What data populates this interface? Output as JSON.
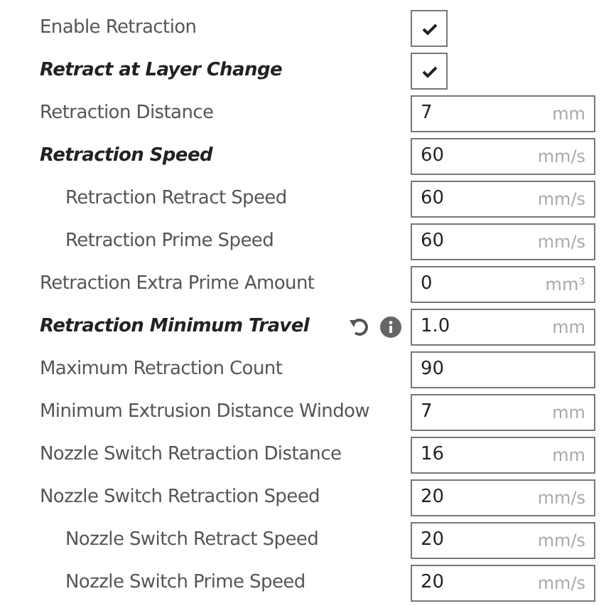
{
  "settings": [
    {
      "label": "Enable Retraction",
      "kind": "checkbox",
      "modified": false,
      "hovered": false,
      "checked": true
    },
    {
      "label": "Retract at Layer Change",
      "kind": "checkbox",
      "modified": true,
      "hovered": false,
      "checked": true
    },
    {
      "label": "Retraction Distance",
      "kind": "number",
      "modified": false,
      "hovered": false,
      "value": "7",
      "unit": "mm"
    },
    {
      "label": "Retraction Speed",
      "kind": "number",
      "modified": true,
      "hovered": false,
      "value": "60",
      "unit": "mm/s",
      "children": [
        {
          "label": "Retraction Retract Speed",
          "kind": "number",
          "modified": false,
          "hovered": false,
          "value": "60",
          "unit": "mm/s"
        },
        {
          "label": "Retraction Prime Speed",
          "kind": "number",
          "modified": false,
          "hovered": false,
          "value": "60",
          "unit": "mm/s"
        }
      ]
    },
    {
      "label": "Retraction Extra Prime Amount",
      "kind": "number",
      "modified": false,
      "hovered": false,
      "value": "0",
      "unit": "mm³"
    },
    {
      "label": "Retraction Minimum Travel",
      "kind": "number",
      "modified": true,
      "hovered": true,
      "value": "1.0",
      "unit": "mm"
    },
    {
      "label": "Maximum Retraction Count",
      "kind": "number",
      "modified": false,
      "hovered": false,
      "value": "90"
    },
    {
      "label": "Minimum Extrusion Distance Window",
      "kind": "number",
      "modified": false,
      "hovered": false,
      "value": "7",
      "unit": "mm"
    },
    {
      "label": "Nozzle Switch Retraction Distance",
      "kind": "number",
      "modified": false,
      "hovered": false,
      "value": "16",
      "unit": "mm"
    },
    {
      "label": "Nozzle Switch Retraction Speed",
      "kind": "number",
      "modified": false,
      "hovered": false,
      "value": "20",
      "unit": "mm/s",
      "children": [
        {
          "label": "Nozzle Switch Retract Speed",
          "kind": "number",
          "modified": false,
          "hovered": false,
          "value": "20",
          "unit": "mm/s"
        },
        {
          "label": "Nozzle Switch Prime Speed",
          "kind": "number",
          "modified": false,
          "hovered": false,
          "value": "20",
          "unit": "mm/s"
        }
      ]
    }
  ]
}
